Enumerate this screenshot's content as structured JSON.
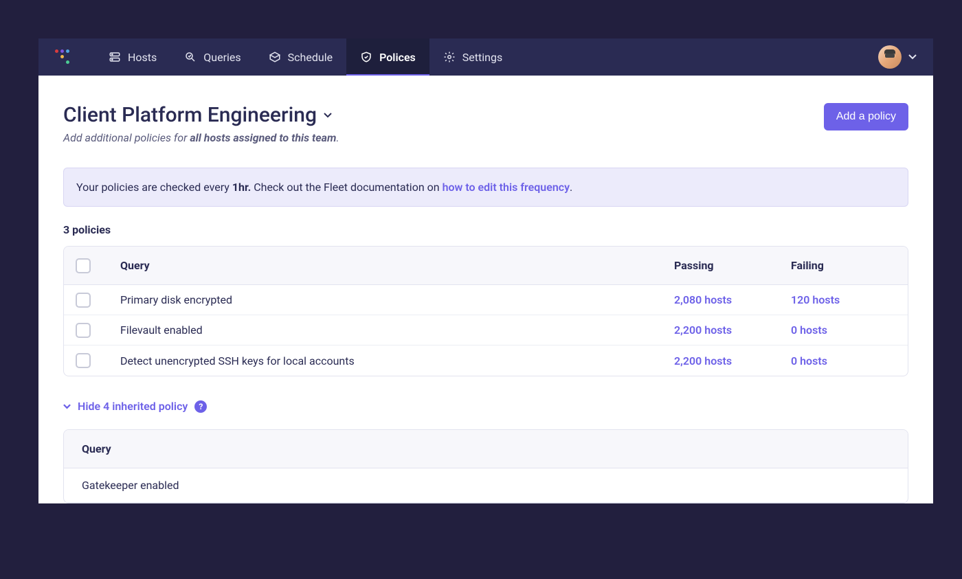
{
  "nav": {
    "items": [
      {
        "label": "Hosts"
      },
      {
        "label": "Queries"
      },
      {
        "label": "Schedule"
      },
      {
        "label": "Polices"
      },
      {
        "label": "Settings"
      }
    ]
  },
  "header": {
    "title": "Client Platform Engineering",
    "subtitle_prefix": "Add additional policies for ",
    "subtitle_emph": "all hosts assigned to this team",
    "subtitle_suffix": ".",
    "add_button": "Add a policy"
  },
  "banner": {
    "prefix": "Your policies are checked every ",
    "freq": "1hr.",
    "mid": " Check out the Fleet documentation on ",
    "link": "how to edit this frequency",
    "suffix": "."
  },
  "policies": {
    "count_label": "3 policies",
    "columns": {
      "query": "Query",
      "passing": "Passing",
      "failing": "Failing"
    },
    "rows": [
      {
        "query": "Primary disk encrypted",
        "passing": "2,080 hosts",
        "failing": "120 hosts"
      },
      {
        "query": "Filevault enabled",
        "passing": "2,200 hosts",
        "failing": "0 hosts"
      },
      {
        "query": "Detect unencrypted SSH keys for local accounts",
        "passing": "2,200 hosts",
        "failing": "0 hosts"
      }
    ]
  },
  "inherited": {
    "toggle_label": "Hide 4 inherited policy",
    "help": "?",
    "column": "Query",
    "rows": [
      {
        "query": "Gatekeeper enabled"
      }
    ]
  }
}
